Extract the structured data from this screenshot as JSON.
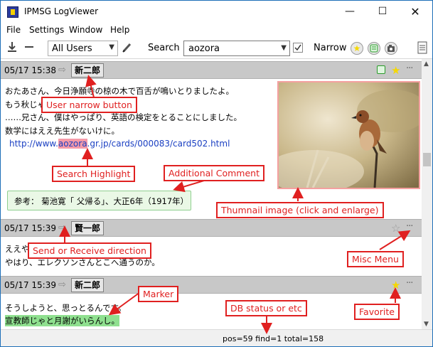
{
  "window": {
    "title": "IPMSG LogViewer",
    "min": "—",
    "max": "☐",
    "close": "✕"
  },
  "menu": [
    "File",
    "Settings",
    "Window",
    "Help"
  ],
  "toolbar": {
    "users_value": "All Users",
    "search_label": "Search",
    "search_value": "aozora",
    "narrow_label": "Narrow"
  },
  "messages": [
    {
      "date": "05/17 15:38",
      "user": "新二郎",
      "lines": [
        "おたあさん、今日浄願寺の椋の木で百舌が鳴いとりましたよ。",
        "もう秋じゃ。",
        "……兄さん、僕はやっぱり、英語の検定をとることにしました。",
        "数学にはええ先生がないけに。"
      ],
      "link_pre": "http://www.",
      "link_hl": "aozora",
      "link_post": ".gr.jp/cards/000083/card502.html",
      "comment": "参考：  菊池寛「 父帰る」、大正6年（1917年）"
    },
    {
      "date": "05/17 15:39",
      "user": "賢一郎",
      "lines": [
        "ええや",
        "やはり、エレクソンさんとこへ通うのか。"
      ]
    },
    {
      "date": "05/17 15:39",
      "user": "新二郎",
      "lines": [
        "そうしようと、思っとるんです。"
      ],
      "marked": "宣教師じゃと月謝がいらんし。"
    }
  ],
  "status": "pos=59 find=1 total=158",
  "annotations": {
    "user_narrow": "User narrow button",
    "search_highlight": "Search Highlight",
    "additional_comment": "Additional Comment",
    "thumbnail": "Thumnail image (click and enlarge)",
    "direction": "Send or Receive direction",
    "misc_menu": "Misc Menu",
    "marker": "Marker",
    "db_status": "DB status or etc",
    "favorite": "Favorite"
  },
  "colors": {
    "favorite": "#f5d800",
    "annotation": "#e02020",
    "marker": "#8fe08f",
    "highlight": "#f59aa8"
  }
}
